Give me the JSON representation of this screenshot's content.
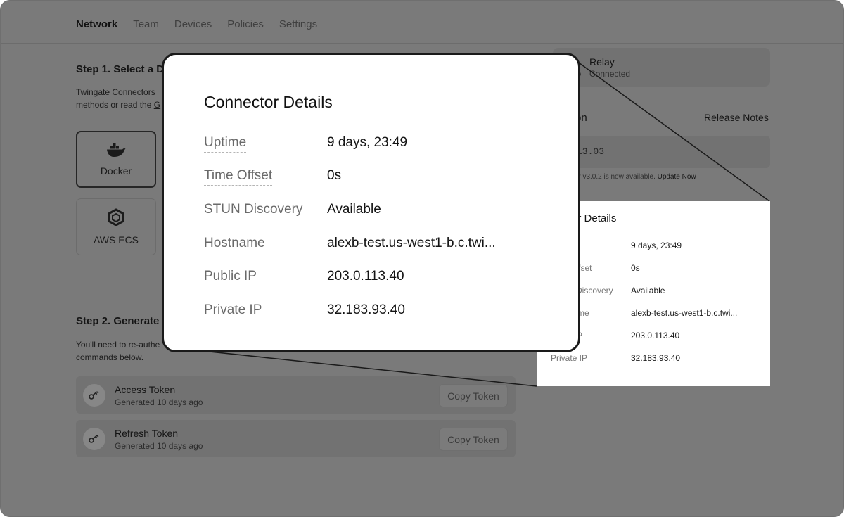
{
  "nav": {
    "tabs": [
      {
        "label": "Network"
      },
      {
        "label": "Team"
      },
      {
        "label": "Devices"
      },
      {
        "label": "Policies"
      },
      {
        "label": "Settings"
      }
    ],
    "active": "Network"
  },
  "step1": {
    "title": "Step 1. Select a D",
    "line1": "Twingate Connectors",
    "line2_prefix": "methods or read the ",
    "line2_link": "G"
  },
  "methods": [
    {
      "label": "Docker",
      "icon": "docker-icon",
      "selected": true
    },
    {
      "label": "AWS ECS",
      "icon": "hexagon-icon",
      "selected": false
    }
  ],
  "step2": {
    "title": "Step 2. Generate",
    "line1": "You'll need to re-authe",
    "line2": "commands below."
  },
  "tokens": [
    {
      "name": "Access Token",
      "generated": "Generated 10 days ago",
      "button": "Copy Token"
    },
    {
      "name": "Refresh Token",
      "generated": "Generated 10 days ago",
      "button": "Copy Token"
    }
  ],
  "relay": {
    "title": "Relay",
    "status": "Connected"
  },
  "version": {
    "title": "on",
    "release_notes": "Release Notes",
    "code": "13.03",
    "update_text": "ctor v3.0.2 is now available.",
    "update_link": "Update Now"
  },
  "small_panel": {
    "title": "ector Details",
    "rows": [
      {
        "label": "",
        "value": "9 days, 23:49"
      },
      {
        "label": "ffset",
        "value": "0s"
      },
      {
        "label": "Discovery",
        "value": "Available"
      },
      {
        "label": "me",
        "value": "alexb-test.us-west1-b.c.twi..."
      },
      {
        "label": "P",
        "value": "203.0.113.40"
      },
      {
        "label": "Private IP",
        "value": "32.183.93.40"
      }
    ]
  },
  "modal": {
    "title": "Connector Details",
    "rows": [
      {
        "label": "Uptime",
        "value": "9 days, 23:49"
      },
      {
        "label": "Time Offset",
        "value": "0s"
      },
      {
        "label": "STUN Discovery",
        "value": "Available"
      },
      {
        "label": "Hostname",
        "value": "alexb-test.us-west1-b.c.twi..."
      },
      {
        "label": "Public IP",
        "value": "203.0.113.40"
      },
      {
        "label": "Private IP",
        "value": "32.183.93.40"
      }
    ]
  },
  "colors": {
    "overlay": "#7a7a7a",
    "modal_bg": "#ffffff",
    "modal_border": "#1a1a1a"
  }
}
